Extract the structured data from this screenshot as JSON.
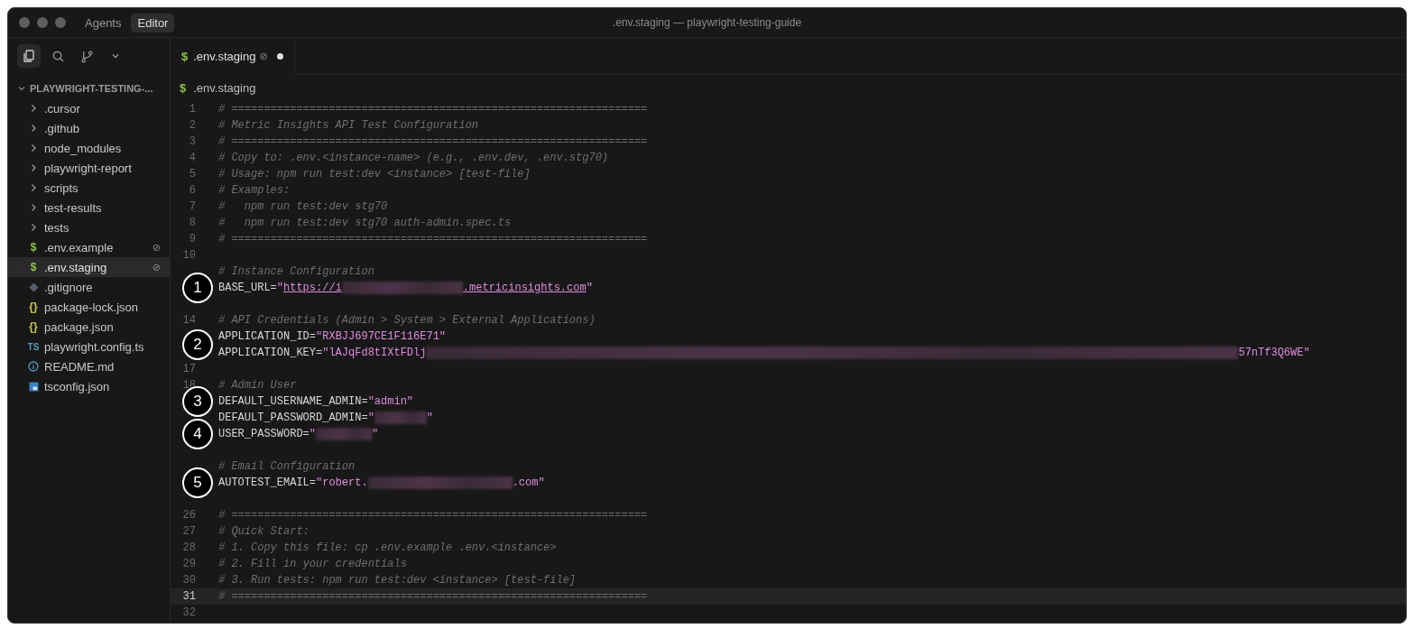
{
  "window": {
    "title": ".env.staging — playwright-testing-guide"
  },
  "mode_tabs": [
    {
      "label": "Agents",
      "selected": false
    },
    {
      "label": "Editor",
      "selected": true
    }
  ],
  "sidebar_tools": [
    {
      "kind": "files",
      "selected": true
    },
    {
      "kind": "search",
      "selected": false
    },
    {
      "kind": "branch",
      "selected": false
    },
    {
      "kind": "more",
      "selected": false
    }
  ],
  "explorer": {
    "title": "PLAYWRIGHT-TESTING-...",
    "expanded": true,
    "items": [
      {
        "kind": "folder",
        "label": ".cursor",
        "selected": false
      },
      {
        "kind": "folder",
        "label": ".github",
        "selected": false
      },
      {
        "kind": "folder",
        "label": "node_modules",
        "selected": false
      },
      {
        "kind": "folder",
        "label": "playwright-report",
        "selected": false
      },
      {
        "kind": "folder",
        "label": "scripts",
        "selected": false
      },
      {
        "kind": "folder",
        "label": "test-results",
        "selected": false
      },
      {
        "kind": "folder",
        "label": "tests",
        "selected": false
      },
      {
        "kind": "env",
        "glyph": "$",
        "label": ".env.example",
        "badge": "⊘",
        "selected": false
      },
      {
        "kind": "env",
        "glyph": "$",
        "label": ".env.staging",
        "badge": "⊘",
        "selected": true
      },
      {
        "kind": "git",
        "label": ".gitignore",
        "selected": false
      },
      {
        "kind": "json",
        "glyph": "{}",
        "label": "package-lock.json",
        "selected": false
      },
      {
        "kind": "json",
        "glyph": "{}",
        "label": "package.json",
        "selected": false
      },
      {
        "kind": "ts",
        "glyph": "TS",
        "label": "playwright.config.ts",
        "selected": false
      },
      {
        "kind": "info",
        "label": "README.md",
        "selected": false
      },
      {
        "kind": "tsconfig",
        "label": "tsconfig.json",
        "selected": false
      }
    ]
  },
  "editor_tabs": [
    {
      "glyph": "$",
      "label": ".env.staging",
      "badge": "⊘",
      "modified": true,
      "selected": true
    }
  ],
  "breadcrumb": {
    "glyph": "$",
    "label": ".env.staging"
  },
  "code_lines": [
    {
      "number": "1",
      "current": false,
      "parts": [
        {
          "kind": "comment",
          "text": "# ================================================================"
        }
      ]
    },
    {
      "number": "2",
      "current": false,
      "parts": [
        {
          "kind": "comment",
          "text": "# Metric Insights API Test Configuration"
        }
      ]
    },
    {
      "number": "3",
      "current": false,
      "parts": [
        {
          "kind": "comment",
          "text": "# ================================================================"
        }
      ]
    },
    {
      "number": "4",
      "current": false,
      "parts": [
        {
          "kind": "comment",
          "text": "# Copy to: .env.<instance-name> (e.g., .env.dev, .env.stg70)"
        }
      ]
    },
    {
      "number": "5",
      "current": false,
      "parts": [
        {
          "kind": "comment",
          "text": "# Usage: npm run test:dev <instance> [test-file]"
        }
      ]
    },
    {
      "number": "6",
      "current": false,
      "parts": [
        {
          "kind": "comment",
          "text": "# Examples:"
        }
      ]
    },
    {
      "number": "7",
      "current": false,
      "parts": [
        {
          "kind": "comment",
          "text": "#   npm run test:dev stg70"
        }
      ]
    },
    {
      "number": "8",
      "current": false,
      "parts": [
        {
          "kind": "comment",
          "text": "#   npm run test:dev stg70 auth-admin.spec.ts"
        }
      ]
    },
    {
      "number": "9",
      "current": false,
      "parts": [
        {
          "kind": "comment",
          "text": "# ================================================================"
        }
      ]
    },
    {
      "number": "10",
      "current": false
    },
    {
      "current": false,
      "parts": [
        {
          "kind": "comment",
          "text": "# Instance Configuration"
        }
      ]
    },
    {
      "current": false,
      "callout": "1",
      "parts": [
        {
          "kind": "key",
          "text": "BASE_URL="
        },
        {
          "kind": "string",
          "text": "\""
        },
        {
          "kind": "link",
          "text": "https://i"
        },
        {
          "kind": "redacted"
        },
        {
          "kind": "link",
          "text": ".metricinsights.com"
        },
        {
          "kind": "string",
          "text": "\""
        }
      ]
    },
    {
      "current": false
    },
    {
      "number": "14",
      "current": false,
      "parts": [
        {
          "kind": "comment",
          "text": "# API Credentials (Admin > System > External Applications)"
        }
      ]
    },
    {
      "current": false,
      "callout": "2",
      "parts": [
        {
          "kind": "key",
          "text": "APPLICATION_ID="
        },
        {
          "kind": "string",
          "text": "\"RXBJJ697CE1F116E71\""
        }
      ]
    },
    {
      "current": false,
      "parts": [
        {
          "kind": "key",
          "text": "APPLICATION_KEY="
        },
        {
          "kind": "string",
          "text": "\"lAJqFd8tIXtFDlj"
        },
        {
          "kind": "redacted"
        },
        {
          "kind": "string",
          "text": "57nTf3Q6WE\""
        }
      ]
    },
    {
      "number": "17",
      "current": false
    },
    {
      "number": "18",
      "current": false,
      "parts": [
        {
          "kind": "comment",
          "text": "# Admin User"
        }
      ]
    },
    {
      "current": false,
      "callout": "3",
      "parts": [
        {
          "kind": "key",
          "text": "DEFAULT_USERNAME_ADMIN="
        },
        {
          "kind": "string",
          "text": "\"admin\""
        }
      ]
    },
    {
      "current": false,
      "parts": [
        {
          "kind": "key",
          "text": "DEFAULT_PASSWORD_ADMIN="
        },
        {
          "kind": "string",
          "text": "\""
        },
        {
          "kind": "redacted"
        },
        {
          "kind": "string",
          "text": "\""
        }
      ]
    },
    {
      "current": false,
      "callout": "4",
      "parts": [
        {
          "kind": "key",
          "text": "USER_PASSWORD="
        },
        {
          "kind": "string",
          "text": "\""
        },
        {
          "kind": "redacted"
        },
        {
          "kind": "string",
          "text": "\""
        }
      ]
    },
    {
      "current": false
    },
    {
      "current": false,
      "parts": [
        {
          "kind": "comment",
          "text": "# Email Configuration"
        }
      ]
    },
    {
      "current": false,
      "callout": "5",
      "parts": [
        {
          "kind": "key",
          "text": "AUTOTEST_EMAIL="
        },
        {
          "kind": "string",
          "text": "\"robert."
        },
        {
          "kind": "redacted"
        },
        {
          "kind": "string",
          "text": ".com\""
        }
      ]
    },
    {
      "current": false
    },
    {
      "number": "26",
      "current": false,
      "parts": [
        {
          "kind": "comment",
          "text": "# ================================================================"
        }
      ]
    },
    {
      "number": "27",
      "current": false,
      "parts": [
        {
          "kind": "comment",
          "text": "# Quick Start:"
        }
      ]
    },
    {
      "number": "28",
      "current": false,
      "parts": [
        {
          "kind": "comment",
          "text": "# 1. Copy this file: cp .env.example .env.<instance>"
        }
      ]
    },
    {
      "number": "29",
      "current": false,
      "parts": [
        {
          "kind": "comment",
          "text": "# 2. Fill in your credentials"
        }
      ]
    },
    {
      "number": "30",
      "current": false,
      "parts": [
        {
          "kind": "comment",
          "text": "# 3. Run tests: npm run test:dev <instance> [test-file]"
        }
      ]
    },
    {
      "number": "31",
      "current": true,
      "parts": [
        {
          "kind": "comment",
          "text": "# ================================================================"
        }
      ]
    },
    {
      "number": "32",
      "current": false
    }
  ]
}
